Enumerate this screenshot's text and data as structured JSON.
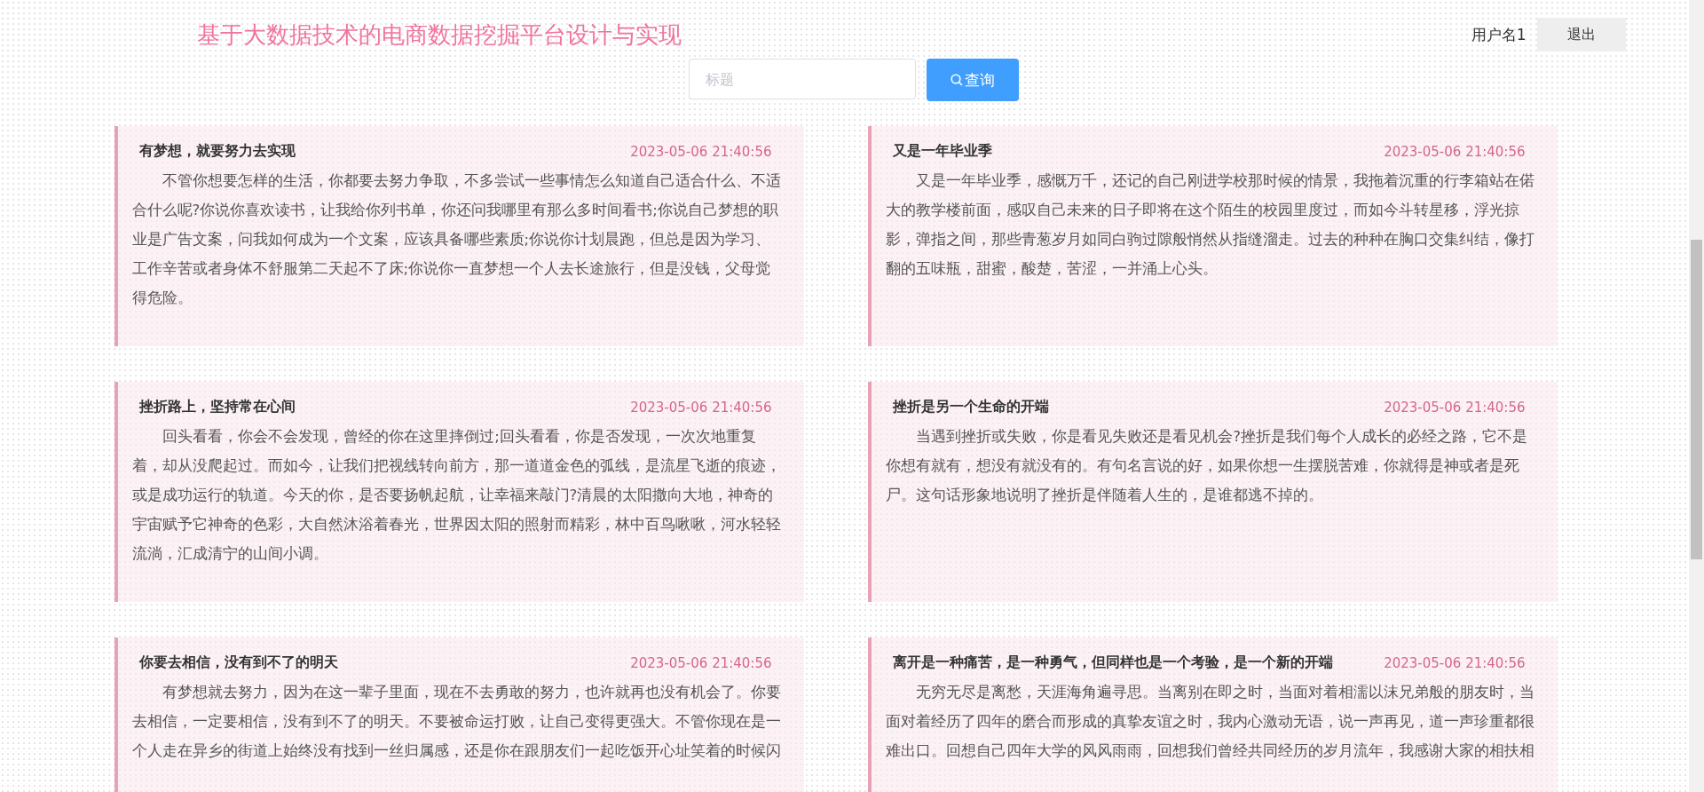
{
  "header": {
    "title": "基于大数据技术的电商数据挖掘平台设计与实现",
    "username": "用户名1",
    "logout": "退出"
  },
  "search": {
    "placeholder": "标题",
    "button": "查询"
  },
  "articles": [
    {
      "title": "有梦想，就要努力去实现",
      "date": "2023-05-06 21:40:56",
      "body": "不管你想要怎样的生活，你都要去努力争取，不多尝试一些事情怎么知道自己适合什么、不适合什么呢?你说你喜欢读书，让我给你列书单，你还问我哪里有那么多时间看书;你说自己梦想的职业是广告文案，问我如何成为一个文案，应该具备哪些素质;你说你计划晨跑，但总是因为学习、工作辛苦或者身体不舒服第二天起不了床;你说你一直梦想一个人去长途旅行，但是没钱，父母觉得危险。"
    },
    {
      "title": "又是一年毕业季",
      "date": "2023-05-06 21:40:56",
      "body": "又是一年毕业季，感慨万千，还记的自己刚进学校那时候的情景，我拖着沉重的行李箱站在偌大的教学楼前面，感叹自己未来的日子即将在这个陌生的校园里度过，而如今斗转星移，浮光掠影，弹指之间，那些青葱岁月如同白驹过隙般悄然从指缝溜走。过去的种种在胸口交集纠结，像打翻的五味瓶，甜蜜，酸楚，苦涩，一并涌上心头。"
    },
    {
      "title": "挫折路上，坚持常在心间",
      "date": "2023-05-06 21:40:56",
      "body": "回头看看，你会不会发现，曾经的你在这里摔倒过;回头看看，你是否发现，一次次地重复着，却从没爬起过。而如今，让我们把视线转向前方，那一道道金色的弧线，是流星飞逝的痕迹，或是成功运行的轨道。今天的你，是否要扬帆起航，让幸福来敲门?清晨的太阳撒向大地，神奇的宇宙赋予它神奇的色彩，大自然沐浴着春光，世界因太阳的照射而精彩，林中百鸟啾啾，河水轻轻流淌，汇成清宁的山间小调。"
    },
    {
      "title": "挫折是另一个生命的开端",
      "date": "2023-05-06 21:40:56",
      "body": "当遇到挫折或失败，你是看见失败还是看见机会?挫折是我们每个人成长的必经之路，它不是你想有就有，想没有就没有的。有句名言说的好，如果你想一生摆脱苦难，你就得是神或者是死尸。这句话形象地说明了挫折是伴随着人生的，是谁都逃不掉的。"
    },
    {
      "title": "你要去相信，没有到不了的明天",
      "date": "2023-05-06 21:40:56",
      "body": "有梦想就去努力，因为在这一辈子里面，现在不去勇敢的努力，也许就再也没有机会了。你要去相信，一定要相信，没有到不了的明天。不要被命运打败，让自己变得更强大。不管你现在是一个人走在异乡的街道上始终没有找到一丝归属感，还是你在跟朋友们一起吃饭开心址笑着的时候闪"
    },
    {
      "title": "离开是一种痛苦，是一种勇气，但同样也是一个考验，是一个新的开端",
      "date": "2023-05-06 21:40:56",
      "body": "无穷无尽是离愁，天涯海角遍寻思。当离别在即之时，当面对着相濡以沫兄弟般的朋友时，当面对着经历了四年的磨合而形成的真挚友谊之时，我内心激动无语，说一声再见，道一声珍重都很难出口。回想自己四年大学的风风雨雨，回想我们曾经共同经历的岁月流年，我感谢大家的相扶相"
    }
  ]
}
